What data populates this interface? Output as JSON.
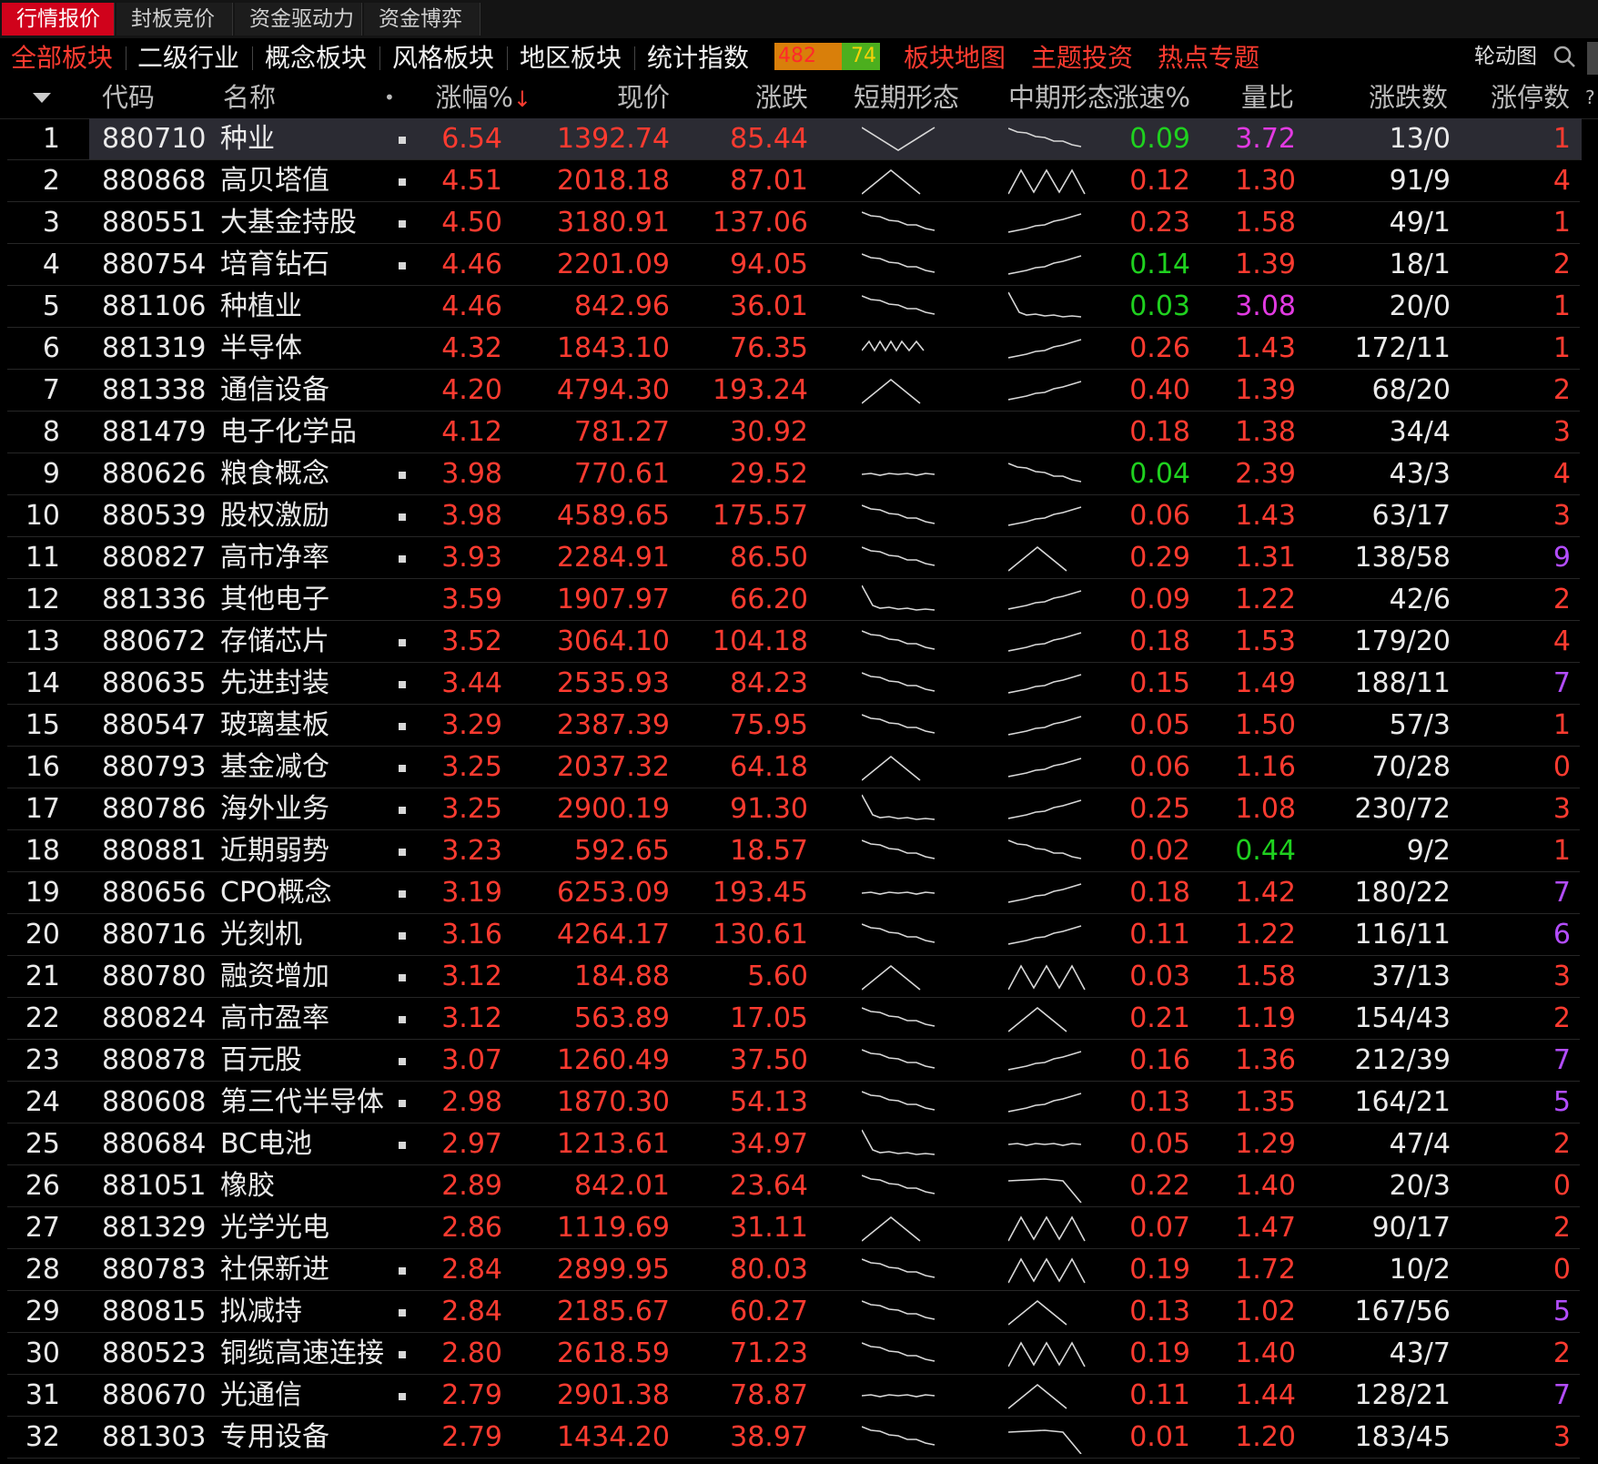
{
  "tabs": [
    {
      "label": "行情报价",
      "active": true
    },
    {
      "label": "封板竞价",
      "active": false
    },
    {
      "label": "资金驱动力",
      "active": false
    },
    {
      "label": "资金博弈",
      "active": false
    }
  ],
  "categories": [
    {
      "label": "全部板块",
      "style": "active"
    },
    {
      "label": "二级行业",
      "style": "normal"
    },
    {
      "label": "概念板块",
      "style": "normal"
    },
    {
      "label": "风格板块",
      "style": "normal"
    },
    {
      "label": "地区板块",
      "style": "normal"
    },
    {
      "label": "统计指数",
      "style": "normal"
    }
  ],
  "counter": {
    "up": "482",
    "down": "74"
  },
  "links": [
    "板块地图",
    "主题投资",
    "热点专题"
  ],
  "rotate_label": "轮动图",
  "headers": {
    "code": "代码",
    "name": "名称",
    "mark": "•",
    "pct": "涨幅%",
    "price": "现价",
    "chg": "涨跌",
    "short": "短期形态",
    "mid": "中期形态",
    "speed": "涨速%",
    "vr": "量比",
    "updown": "涨跌数",
    "limit": "涨停数",
    "help": "?"
  },
  "rows": [
    {
      "idx": "1",
      "code": "880710",
      "name": "种业",
      "mark": true,
      "pct": "6.54",
      "price": "1392.74",
      "chg": "85.44",
      "short": "vdown",
      "mid": "desc",
      "speed": "0.09",
      "speed_color": "green",
      "vr": "3.72",
      "vr_color": "mag",
      "updown": "13/0",
      "limit": "1",
      "limit_color": "red"
    },
    {
      "idx": "2",
      "code": "880868",
      "name": "高贝塔值",
      "mark": true,
      "pct": "4.51",
      "price": "2018.18",
      "chg": "87.01",
      "short": "peak",
      "mid": "mm",
      "speed": "0.12",
      "speed_color": "red",
      "vr": "1.30",
      "vr_color": "red",
      "updown": "91/9",
      "limit": "4",
      "limit_color": "red"
    },
    {
      "idx": "3",
      "code": "880551",
      "name": "大基金持股",
      "mark": true,
      "pct": "4.50",
      "price": "3180.91",
      "chg": "137.06",
      "short": "desc",
      "mid": "asc",
      "speed": "0.23",
      "speed_color": "red",
      "vr": "1.58",
      "vr_color": "red",
      "updown": "49/1",
      "limit": "1",
      "limit_color": "red"
    },
    {
      "idx": "4",
      "code": "880754",
      "name": "培育钻石",
      "mark": true,
      "pct": "4.46",
      "price": "2201.09",
      "chg": "94.05",
      "short": "desc",
      "mid": "asc",
      "speed": "0.14",
      "speed_color": "green",
      "vr": "1.39",
      "vr_color": "red",
      "updown": "18/1",
      "limit": "2",
      "limit_color": "red"
    },
    {
      "idx": "5",
      "code": "881106",
      "name": "种植业",
      "mark": false,
      "pct": "4.46",
      "price": "842.96",
      "chg": "36.01",
      "short": "desc",
      "mid": "drop",
      "speed": "0.03",
      "speed_color": "green",
      "vr": "3.08",
      "vr_color": "mag",
      "updown": "20/0",
      "limit": "1",
      "limit_color": "red"
    },
    {
      "idx": "6",
      "code": "881319",
      "name": "半导体",
      "mark": false,
      "pct": "4.32",
      "price": "1843.10",
      "chg": "76.35",
      "short": "na",
      "mid": "asc",
      "speed": "0.26",
      "speed_color": "red",
      "vr": "1.43",
      "vr_color": "red",
      "updown": "172/11",
      "limit": "1",
      "limit_color": "red"
    },
    {
      "idx": "7",
      "code": "881338",
      "name": "通信设备",
      "mark": false,
      "pct": "4.20",
      "price": "4794.30",
      "chg": "193.24",
      "short": "peak",
      "mid": "asc",
      "speed": "0.40",
      "speed_color": "red",
      "vr": "1.39",
      "vr_color": "red",
      "updown": "68/20",
      "limit": "2",
      "limit_color": "red"
    },
    {
      "idx": "8",
      "code": "881479",
      "name": "电子化学品",
      "mark": false,
      "pct": "4.12",
      "price": "781.27",
      "chg": "30.92",
      "short": "none",
      "mid": "none",
      "speed": "0.18",
      "speed_color": "red",
      "vr": "1.38",
      "vr_color": "red",
      "updown": "34/4",
      "limit": "3",
      "limit_color": "red"
    },
    {
      "idx": "9",
      "code": "880626",
      "name": "粮食概念",
      "mark": true,
      "pct": "3.98",
      "price": "770.61",
      "chg": "29.52",
      "short": "flat",
      "mid": "desc",
      "speed": "0.04",
      "speed_color": "green",
      "vr": "2.39",
      "vr_color": "red",
      "updown": "43/3",
      "limit": "4",
      "limit_color": "red"
    },
    {
      "idx": "10",
      "code": "880539",
      "name": "股权激励",
      "mark": true,
      "pct": "3.98",
      "price": "4589.65",
      "chg": "175.57",
      "short": "desc",
      "mid": "asc",
      "speed": "0.06",
      "speed_color": "red",
      "vr": "1.43",
      "vr_color": "red",
      "updown": "63/17",
      "limit": "3",
      "limit_color": "red"
    },
    {
      "idx": "11",
      "code": "880827",
      "name": "高市净率",
      "mark": true,
      "pct": "3.93",
      "price": "2284.91",
      "chg": "86.50",
      "short": "desc",
      "mid": "peak",
      "speed": "0.29",
      "speed_color": "red",
      "vr": "1.31",
      "vr_color": "red",
      "updown": "138/58",
      "limit": "9",
      "limit_color": "purple"
    },
    {
      "idx": "12",
      "code": "881336",
      "name": "其他电子",
      "mark": false,
      "pct": "3.59",
      "price": "1907.97",
      "chg": "66.20",
      "short": "drop",
      "mid": "asc",
      "speed": "0.09",
      "speed_color": "red",
      "vr": "1.22",
      "vr_color": "red",
      "updown": "42/6",
      "limit": "2",
      "limit_color": "red"
    },
    {
      "idx": "13",
      "code": "880672",
      "name": "存储芯片",
      "mark": true,
      "pct": "3.52",
      "price": "3064.10",
      "chg": "104.18",
      "short": "desc",
      "mid": "asc",
      "speed": "0.18",
      "speed_color": "red",
      "vr": "1.53",
      "vr_color": "red",
      "updown": "179/20",
      "limit": "4",
      "limit_color": "red"
    },
    {
      "idx": "14",
      "code": "880635",
      "name": "先进封装",
      "mark": true,
      "pct": "3.44",
      "price": "2535.93",
      "chg": "84.23",
      "short": "desc",
      "mid": "asc",
      "speed": "0.15",
      "speed_color": "red",
      "vr": "1.49",
      "vr_color": "red",
      "updown": "188/11",
      "limit": "7",
      "limit_color": "purple"
    },
    {
      "idx": "15",
      "code": "880547",
      "name": "玻璃基板",
      "mark": true,
      "pct": "3.29",
      "price": "2387.39",
      "chg": "75.95",
      "short": "desc",
      "mid": "asc",
      "speed": "0.05",
      "speed_color": "red",
      "vr": "1.50",
      "vr_color": "red",
      "updown": "57/3",
      "limit": "1",
      "limit_color": "red"
    },
    {
      "idx": "16",
      "code": "880793",
      "name": "基金减仓",
      "mark": true,
      "pct": "3.25",
      "price": "2037.32",
      "chg": "64.18",
      "short": "peak",
      "mid": "asc",
      "speed": "0.06",
      "speed_color": "red",
      "vr": "1.16",
      "vr_color": "red",
      "updown": "70/28",
      "limit": "0",
      "limit_color": "red"
    },
    {
      "idx": "17",
      "code": "880786",
      "name": "海外业务",
      "mark": true,
      "pct": "3.25",
      "price": "2900.19",
      "chg": "91.30",
      "short": "drop",
      "mid": "asc",
      "speed": "0.25",
      "speed_color": "red",
      "vr": "1.08",
      "vr_color": "red",
      "updown": "230/72",
      "limit": "3",
      "limit_color": "red"
    },
    {
      "idx": "18",
      "code": "880881",
      "name": "近期弱势",
      "mark": true,
      "pct": "3.23",
      "price": "592.65",
      "chg": "18.57",
      "short": "desc",
      "mid": "desc",
      "speed": "0.02",
      "speed_color": "red",
      "vr": "0.44",
      "vr_color": "green",
      "updown": "9/2",
      "limit": "1",
      "limit_color": "red"
    },
    {
      "idx": "19",
      "code": "880656",
      "name": "CPO概念",
      "mark": true,
      "pct": "3.19",
      "price": "6253.09",
      "chg": "193.45",
      "short": "flat",
      "mid": "asc",
      "speed": "0.18",
      "speed_color": "red",
      "vr": "1.42",
      "vr_color": "red",
      "updown": "180/22",
      "limit": "7",
      "limit_color": "purple"
    },
    {
      "idx": "20",
      "code": "880716",
      "name": "光刻机",
      "mark": true,
      "pct": "3.16",
      "price": "4264.17",
      "chg": "130.61",
      "short": "desc",
      "mid": "asc",
      "speed": "0.11",
      "speed_color": "red",
      "vr": "1.22",
      "vr_color": "red",
      "updown": "116/11",
      "limit": "6",
      "limit_color": "purple"
    },
    {
      "idx": "21",
      "code": "880780",
      "name": "融资增加",
      "mark": true,
      "pct": "3.12",
      "price": "184.88",
      "chg": "5.60",
      "short": "peak",
      "mid": "mm",
      "speed": "0.03",
      "speed_color": "red",
      "vr": "1.58",
      "vr_color": "red",
      "updown": "37/13",
      "limit": "3",
      "limit_color": "red"
    },
    {
      "idx": "22",
      "code": "880824",
      "name": "高市盈率",
      "mark": true,
      "pct": "3.12",
      "price": "563.89",
      "chg": "17.05",
      "short": "desc",
      "mid": "peak",
      "speed": "0.21",
      "speed_color": "red",
      "vr": "1.19",
      "vr_color": "red",
      "updown": "154/43",
      "limit": "2",
      "limit_color": "red"
    },
    {
      "idx": "23",
      "code": "880878",
      "name": "百元股",
      "mark": true,
      "pct": "3.07",
      "price": "1260.49",
      "chg": "37.50",
      "short": "desc",
      "mid": "asc",
      "speed": "0.16",
      "speed_color": "red",
      "vr": "1.36",
      "vr_color": "red",
      "updown": "212/39",
      "limit": "7",
      "limit_color": "purple"
    },
    {
      "idx": "24",
      "code": "880608",
      "name": "第三代半导体",
      "mark": true,
      "pct": "2.98",
      "price": "1870.30",
      "chg": "54.13",
      "short": "desc",
      "mid": "asc",
      "speed": "0.13",
      "speed_color": "red",
      "vr": "1.35",
      "vr_color": "red",
      "updown": "164/21",
      "limit": "5",
      "limit_color": "purple"
    },
    {
      "idx": "25",
      "code": "880684",
      "name": "BC电池",
      "mark": true,
      "pct": "2.97",
      "price": "1213.61",
      "chg": "34.97",
      "short": "drop",
      "mid": "flat",
      "speed": "0.05",
      "speed_color": "red",
      "vr": "1.29",
      "vr_color": "red",
      "updown": "47/4",
      "limit": "2",
      "limit_color": "red"
    },
    {
      "idx": "26",
      "code": "881051",
      "name": "橡胶",
      "mark": false,
      "pct": "2.89",
      "price": "842.01",
      "chg": "23.64",
      "short": "desc",
      "mid": "plateau",
      "speed": "0.22",
      "speed_color": "red",
      "vr": "1.40",
      "vr_color": "red",
      "updown": "20/3",
      "limit": "0",
      "limit_color": "red"
    },
    {
      "idx": "27",
      "code": "881329",
      "name": "光学光电",
      "mark": false,
      "pct": "2.86",
      "price": "1119.69",
      "chg": "31.11",
      "short": "peak",
      "mid": "mm",
      "speed": "0.07",
      "speed_color": "red",
      "vr": "1.47",
      "vr_color": "red",
      "updown": "90/17",
      "limit": "2",
      "limit_color": "red"
    },
    {
      "idx": "28",
      "code": "880783",
      "name": "社保新进",
      "mark": true,
      "pct": "2.84",
      "price": "2899.95",
      "chg": "80.03",
      "short": "desc",
      "mid": "mm",
      "speed": "0.19",
      "speed_color": "red",
      "vr": "1.72",
      "vr_color": "red",
      "updown": "10/2",
      "limit": "0",
      "limit_color": "red"
    },
    {
      "idx": "29",
      "code": "880815",
      "name": "拟减持",
      "mark": true,
      "pct": "2.84",
      "price": "2185.67",
      "chg": "60.27",
      "short": "desc",
      "mid": "peak",
      "speed": "0.13",
      "speed_color": "red",
      "vr": "1.02",
      "vr_color": "red",
      "updown": "167/56",
      "limit": "5",
      "limit_color": "purple"
    },
    {
      "idx": "30",
      "code": "880523",
      "name": "铜缆高速连接",
      "mark": true,
      "pct": "2.80",
      "price": "2618.59",
      "chg": "71.23",
      "short": "desc",
      "mid": "mm",
      "speed": "0.19",
      "speed_color": "red",
      "vr": "1.40",
      "vr_color": "red",
      "updown": "43/7",
      "limit": "2",
      "limit_color": "red"
    },
    {
      "idx": "31",
      "code": "880670",
      "name": "光通信",
      "mark": true,
      "pct": "2.79",
      "price": "2901.38",
      "chg": "78.87",
      "short": "flat",
      "mid": "peak",
      "speed": "0.11",
      "speed_color": "red",
      "vr": "1.44",
      "vr_color": "red",
      "updown": "128/21",
      "limit": "7",
      "limit_color": "purple"
    },
    {
      "idx": "32",
      "code": "881303",
      "name": "专用设备",
      "mark": false,
      "pct": "2.79",
      "price": "1434.20",
      "chg": "38.97",
      "short": "desc",
      "mid": "plateau",
      "speed": "0.01",
      "speed_color": "red",
      "vr": "1.20",
      "vr_color": "red",
      "updown": "183/45",
      "limit": "3",
      "limit_color": "red"
    }
  ]
}
